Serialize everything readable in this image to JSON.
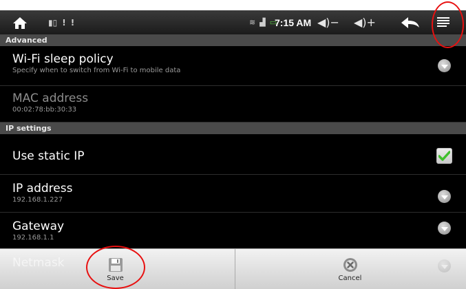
{
  "status_bar": {
    "time": "7:15 AM",
    "vol_down_glyph": "◀)−",
    "vol_up_glyph": "◀)+",
    "notification_glyphs": [
      "▮▯",
      "!",
      "!"
    ]
  },
  "sections": {
    "advanced_header": "Advanced",
    "ip_header": "IP settings"
  },
  "items": {
    "wifi_sleep": {
      "title": "Wi-Fi sleep policy",
      "summary": "Specify when to switch from Wi-Fi to mobile data"
    },
    "mac": {
      "title": "MAC address",
      "summary": "00:02:78:bb:30:33"
    },
    "static_ip": {
      "title": "Use static IP",
      "checked": true
    },
    "ip_address": {
      "title": "IP address",
      "summary": "192.168.1.227"
    },
    "gateway": {
      "title": "Gateway",
      "summary": "192.168.1.1"
    },
    "netmask": {
      "title": "Netmask"
    }
  },
  "actions": {
    "save": "Save",
    "cancel": "Cancel"
  },
  "colors": {
    "annotation": "#e81010",
    "check": "#3fbf2c"
  }
}
